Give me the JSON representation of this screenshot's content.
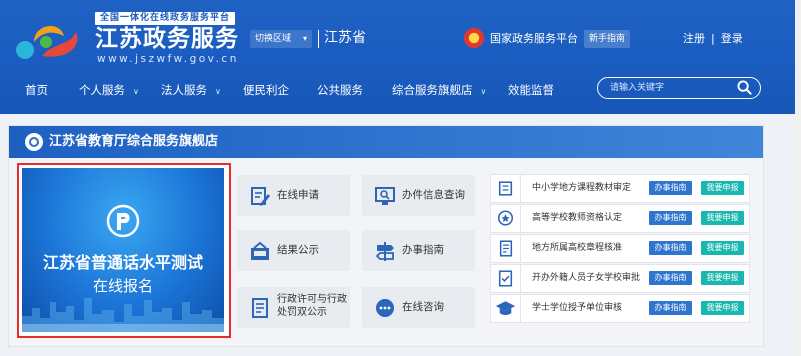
{
  "header": {
    "tagline": "全国一体化在线政务服务平台",
    "site_title": "江苏政务服务",
    "site_domain": "www.jszwfw.gov.cn",
    "region_switch": "切换区域",
    "province": "江苏省",
    "gov_platform": "国家政务服务平台",
    "guide_button": "新手指南",
    "register": "注册",
    "login": "登录"
  },
  "nav": {
    "items": [
      {
        "label": "首页"
      },
      {
        "label": "个人服务"
      },
      {
        "label": "法人服务"
      },
      {
        "label": "便民利企"
      },
      {
        "label": "公共服务"
      },
      {
        "label": "综合服务旗舰店"
      },
      {
        "label": "效能监督"
      }
    ],
    "search_placeholder": "请输入关键字"
  },
  "store": {
    "title": "江苏省教育厅综合服务旗舰店",
    "banner_title": "江苏省普通话水平测试",
    "banner_subtitle": "在线报名",
    "services": [
      {
        "label": "在线申请",
        "icon": "edit-icon"
      },
      {
        "label": "办件信息查询",
        "icon": "monitor-search-icon"
      },
      {
        "label": "结果公示",
        "icon": "notice-board-icon"
      },
      {
        "label": "办事指南",
        "icon": "signpost-icon"
      },
      {
        "label": "行政许可与行政",
        "label2": "处罚双公示",
        "icon": "document-icon"
      },
      {
        "label": "在线咨询",
        "icon": "chat-icon"
      }
    ],
    "items": [
      {
        "label": "中小学地方课程教材审定",
        "icon": "book-icon"
      },
      {
        "label": "高等学校教师资格认定",
        "icon": "badge-icon"
      },
      {
        "label": "地方所属高校章程核准",
        "icon": "form-icon"
      },
      {
        "label": "开办外籍人员子女学校审批",
        "icon": "check-document-icon"
      },
      {
        "label": "学士学位授予单位审核",
        "icon": "graduation-cap-icon"
      }
    ],
    "guide_label": "办事指南",
    "apply_label": "我要申报"
  },
  "colors": {
    "header_blue": "#1a5cbf",
    "guide_badge": "#2f74cf",
    "apply_badge": "#18b7b0",
    "highlight_red": "#e52d2d"
  }
}
